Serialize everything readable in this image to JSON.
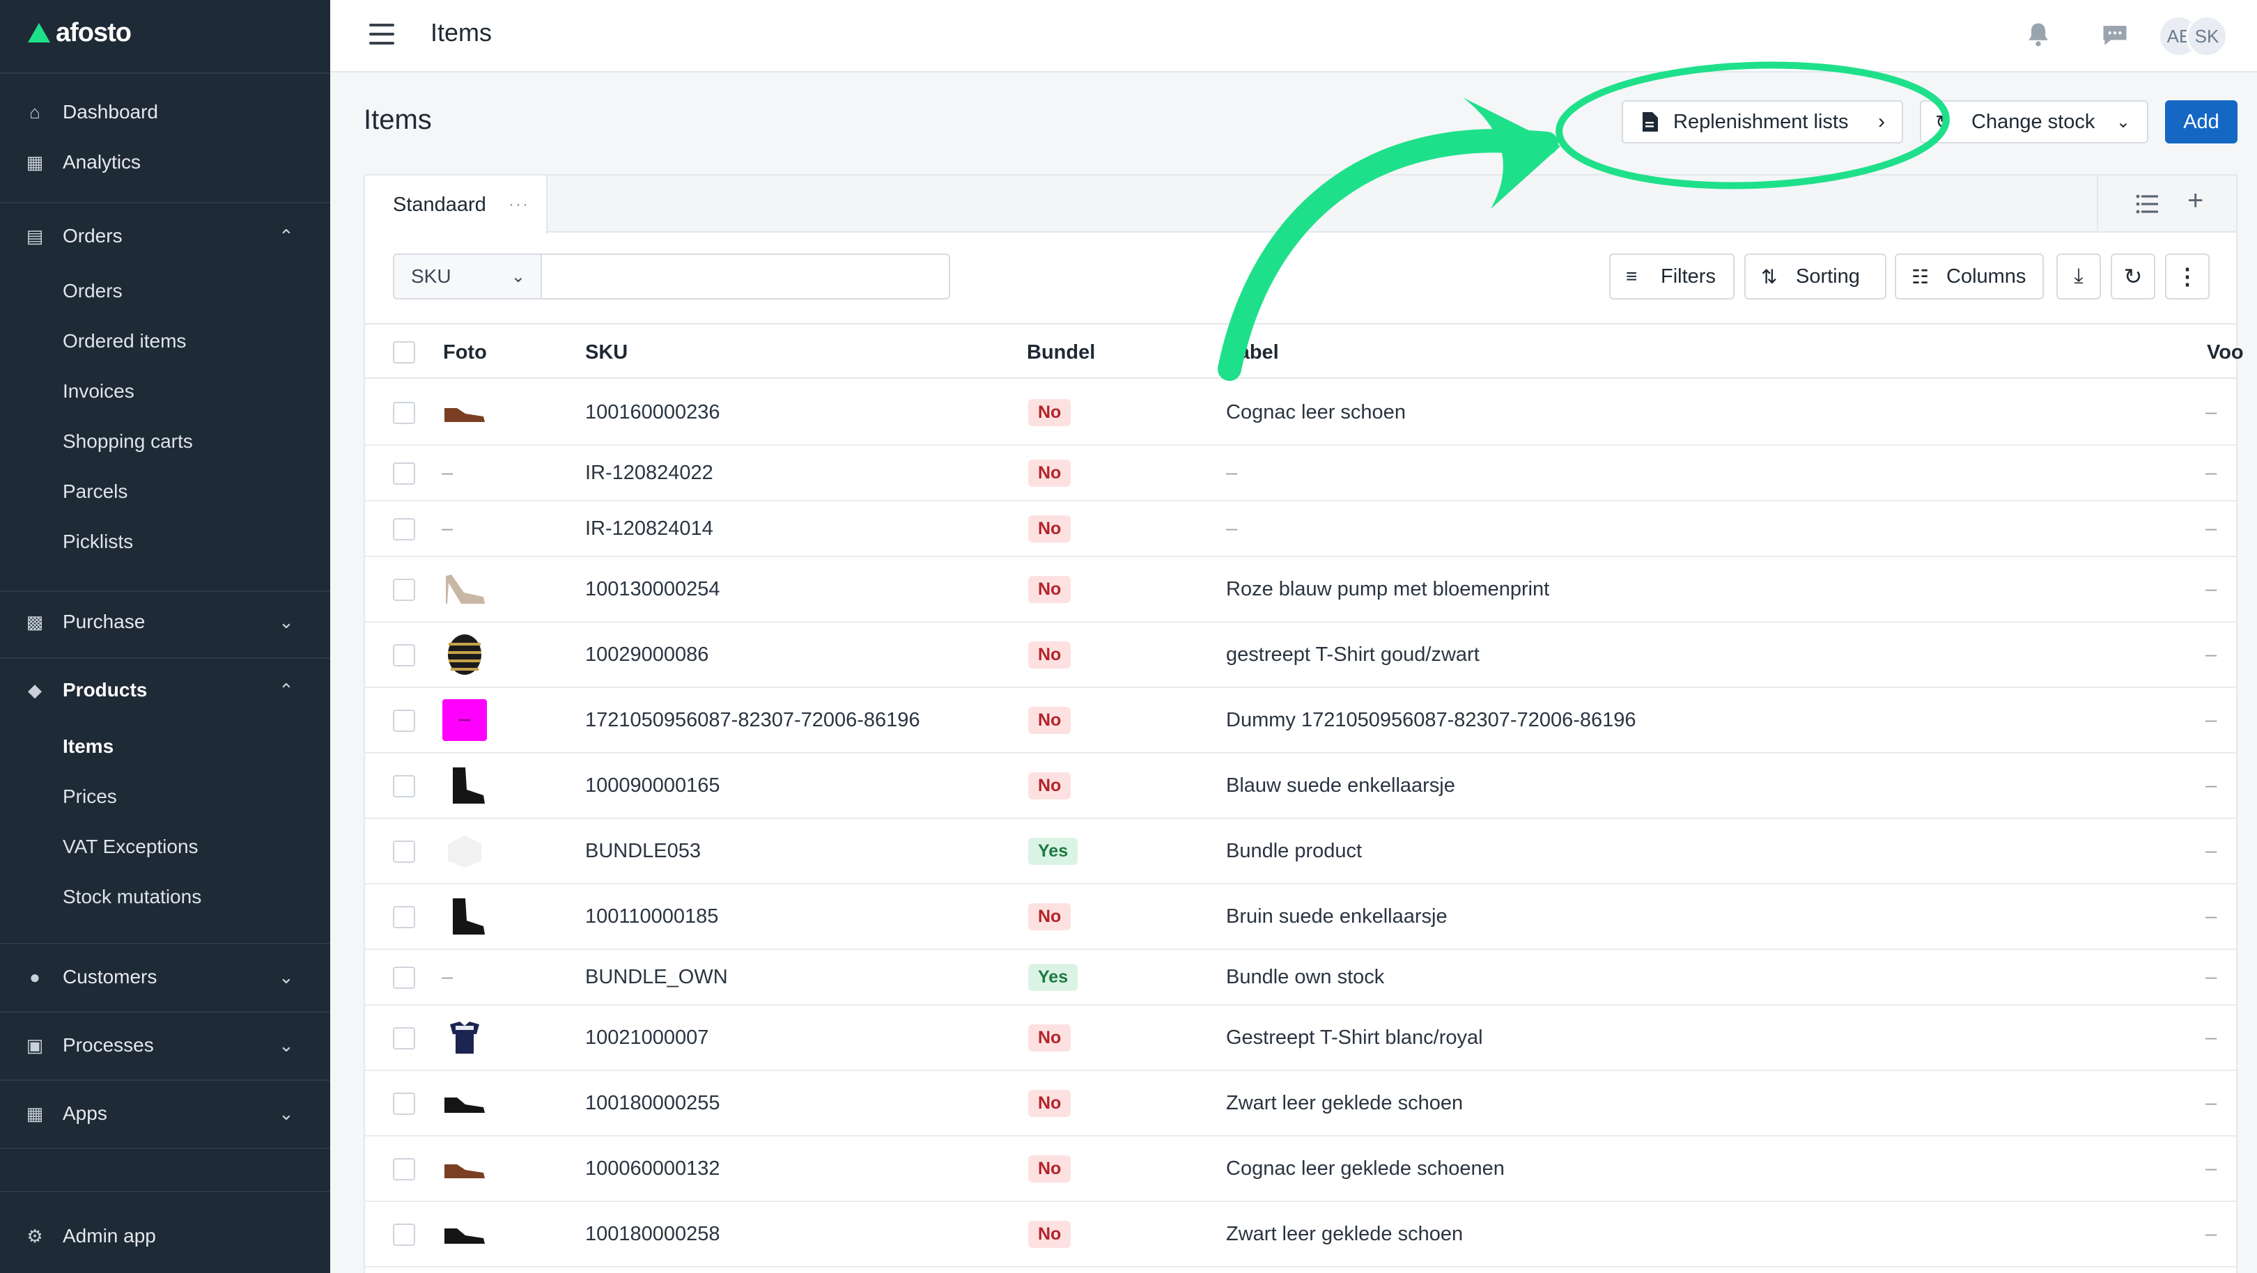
{
  "brand": {
    "name": "afosto",
    "accent": "#1fe08a",
    "sidebar_bg": "#1e2a36",
    "primary": "#1468c4"
  },
  "sidebar": {
    "top_items": [
      {
        "label": "Dashboard",
        "icon": "home-icon"
      },
      {
        "label": "Analytics",
        "icon": "grid-icon"
      }
    ],
    "orders": {
      "label": "Orders",
      "icon": "orders-icon",
      "expanded": true,
      "items": [
        "Orders",
        "Ordered items",
        "Invoices",
        "Shopping carts",
        "Parcels",
        "Picklists"
      ]
    },
    "purchase": {
      "label": "Purchase",
      "icon": "purchase-icon",
      "expanded": false
    },
    "products": {
      "label": "Products",
      "icon": "tag-icon",
      "expanded": true,
      "items": [
        "Items",
        "Prices",
        "VAT Exceptions",
        "Stock mutations"
      ],
      "active_item": "Items"
    },
    "customers": {
      "label": "Customers",
      "icon": "user-icon",
      "expanded": false
    },
    "processes": {
      "label": "Processes",
      "icon": "process-icon",
      "expanded": false
    },
    "apps": {
      "label": "Apps",
      "icon": "apps-icon",
      "expanded": false
    },
    "admin": {
      "label": "Admin app",
      "icon": "gear-icon"
    }
  },
  "topbar": {
    "title": "Items",
    "avatars": [
      "AE",
      "SK"
    ]
  },
  "header": {
    "title": "Items",
    "replenishment_label": "Replenishment lists",
    "change_stock_label": "Change stock",
    "add_label": "Add"
  },
  "tabs": {
    "active": "Standaard",
    "more": "···"
  },
  "toolbar": {
    "search_field": "SKU",
    "filters_label": "Filters",
    "sorting_label": "Sorting",
    "columns_label": "Columns"
  },
  "table": {
    "columns": {
      "photo": "Foto",
      "sku": "SKU",
      "bundle": "Bundel",
      "label": "Label",
      "stock": "Voo"
    },
    "rows": [
      {
        "photo": "brown-shoe",
        "sku": "100160000236",
        "bundle": "No",
        "label": "Cognac leer schoen",
        "stock": "–"
      },
      {
        "photo": "none",
        "sku": "IR-120824022",
        "bundle": "No",
        "label": "–",
        "stock": "–"
      },
      {
        "photo": "none",
        "sku": "IR-120824014",
        "bundle": "No",
        "label": "–",
        "stock": "–"
      },
      {
        "photo": "pump",
        "sku": "100130000254",
        "bundle": "No",
        "label": "Roze blauw pump met bloemenprint",
        "stock": "–"
      },
      {
        "photo": "striped-shirt",
        "sku": "10029000086",
        "bundle": "No",
        "label": "gestreept T-Shirt goud/zwart",
        "stock": "–"
      },
      {
        "photo": "magenta-square",
        "sku": "1721050956087-82307-72006-86196",
        "bundle": "No",
        "label": "Dummy 1721050956087-82307-72006-86196",
        "stock": "–"
      },
      {
        "photo": "black-boot",
        "sku": "100090000165",
        "bundle": "No",
        "label": "Blauw suede enkellaarsje",
        "stock": "–"
      },
      {
        "photo": "white-box",
        "sku": "BUNDLE053",
        "bundle": "Yes",
        "label": "Bundle product",
        "stock": "–"
      },
      {
        "photo": "black-boot",
        "sku": "100110000185",
        "bundle": "No",
        "label": "Bruin suede enkellaarsje",
        "stock": "–"
      },
      {
        "photo": "none",
        "sku": "BUNDLE_OWN",
        "bundle": "Yes",
        "label": "Bundle own stock",
        "stock": "–"
      },
      {
        "photo": "navy-shirt",
        "sku": "10021000007",
        "bundle": "No",
        "label": "Gestreept T-Shirt blanc/royal",
        "stock": "–"
      },
      {
        "photo": "black-shoe",
        "sku": "100180000255",
        "bundle": "No",
        "label": "Zwart leer geklede schoen",
        "stock": "–"
      },
      {
        "photo": "brown-shoe",
        "sku": "100060000132",
        "bundle": "No",
        "label": "Cognac leer geklede schoenen",
        "stock": "–"
      },
      {
        "photo": "black-shoe",
        "sku": "100180000258",
        "bundle": "No",
        "label": "Zwart leer geklede schoen",
        "stock": "–"
      }
    ]
  },
  "annotation": {
    "color": "#1fe08a"
  }
}
